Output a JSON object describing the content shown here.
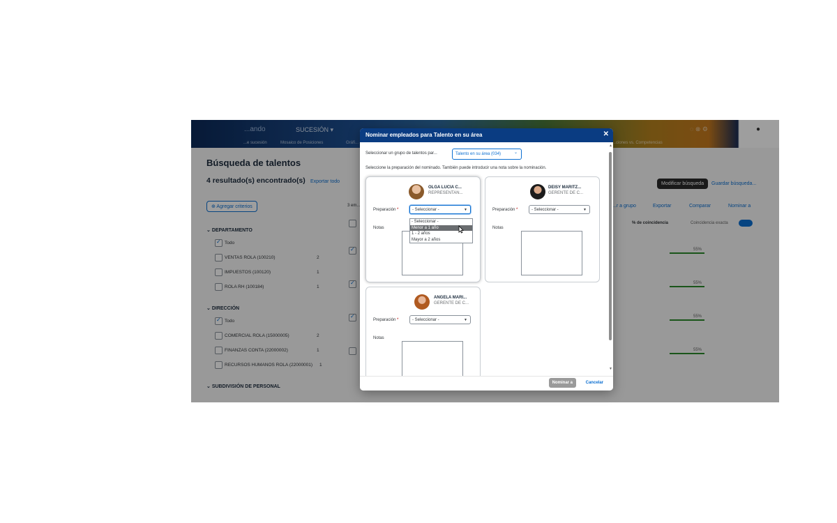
{
  "app": {
    "header": {
      "logo": "...ando",
      "menu": "SUCESIÓN ▾",
      "tab1": "...e sucesión",
      "tab2": "Mosaico de Posiciones",
      "tab3": "Gráfi...",
      "tab_right": "...ciones vs. Competencias"
    },
    "title": "Búsqueda de talentos",
    "results": "4 resultado(s) encontrado(s)",
    "export_all": "Exportar todo",
    "add_criteria": "⊕ Agregar criterios",
    "modify_search": "Modificar búsqueda",
    "save_search": "Guardar búsqueda...",
    "toolbar": {
      "count": "3 em...",
      "to_group": "...r a grupo",
      "export": "Exportar",
      "compare": "Comparar",
      "nominate": "Nominar a"
    },
    "coincidence_label": "% de coincidencia",
    "exact_label": "Coincidencia exacta",
    "row_pcts": [
      "55%",
      "55%",
      "55%",
      "55%"
    ],
    "filters": {
      "departamento": {
        "title": "DEPARTAMENTO",
        "items": [
          {
            "label": "Todo",
            "count": ""
          },
          {
            "label": "VENTAS ROLA (100210)",
            "count": "2"
          },
          {
            "label": "IMPUESTOS (100120)",
            "count": "1"
          },
          {
            "label": "ROLA RH (100184)",
            "count": "1"
          }
        ]
      },
      "direccion": {
        "title": "DIRECCIÓN",
        "items": [
          {
            "label": "Todo",
            "count": ""
          },
          {
            "label": "COMERCIAL ROLA (15000005)",
            "count": "2"
          },
          {
            "label": "FINANZAS CONTA (22000002)",
            "count": "1"
          },
          {
            "label": "RECURSOS HUMANOS ROLA (22000001)",
            "count": "1"
          }
        ]
      },
      "subdivision": {
        "title": "SUBDIVISIÓN DE PERSONAL"
      }
    }
  },
  "dialog": {
    "title": "Nominar empleados para Talento en su área",
    "group_label": "Seleccionar un grupo de talentos par...",
    "group_value": "Talento en su área (034)",
    "instructions": "Seleccione la preparación del nominado. También puede introducir una nota sobre la nominación.",
    "prep_label": "Preparación",
    "required_mark": "*",
    "notes_label": "Notas",
    "select_placeholder": "- Seleccionar -",
    "options": [
      "- Seleccionar -",
      "Menor a 1 año",
      "1 - 2 años",
      "Mayor a 2 años"
    ],
    "highlighted_option": "Menor a 1 año",
    "cards": [
      {
        "name": "OLGA LUCIA C...",
        "role": "REPRESENTAN..."
      },
      {
        "name": "DEISY MARITZ...",
        "role": "GERENTE DE C..."
      },
      {
        "name": "ANGELA MARI...",
        "role": "GERENTE DE C..."
      }
    ],
    "nominate_button": "Nominar a",
    "cancel_button": "Cancelar"
  },
  "colors": {
    "accent": "#0a6ed1",
    "dialog_header": "#0a3c82",
    "required": "#bb0000"
  }
}
